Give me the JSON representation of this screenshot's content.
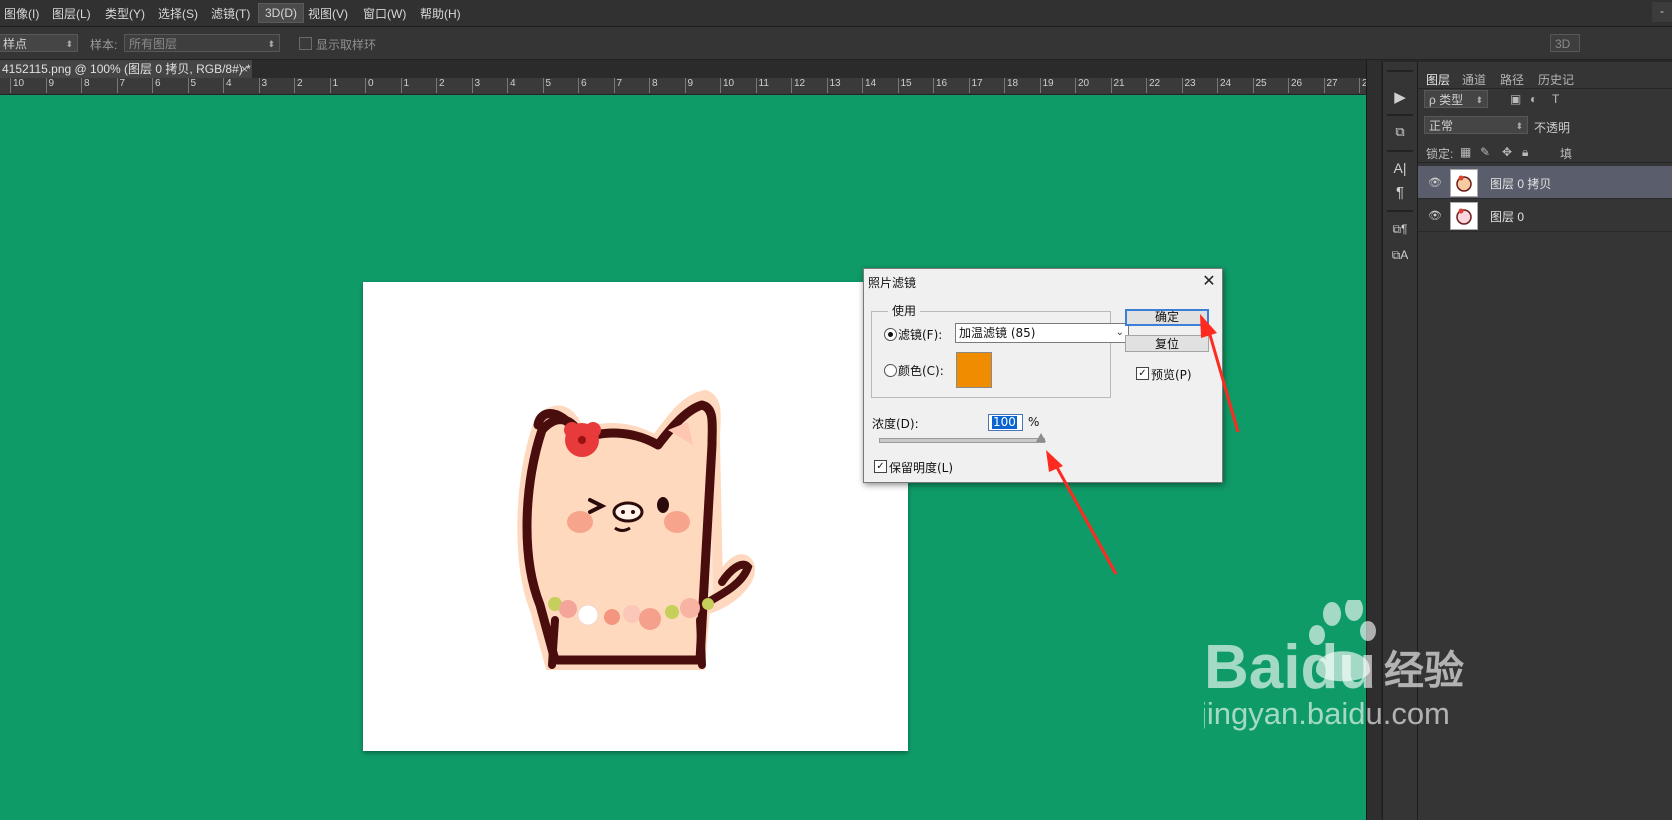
{
  "menu": [
    "图像(I)",
    "图层(L)",
    "类型(Y)",
    "选择(S)",
    "滤镜(T)",
    "3D(D)",
    "视图(V)",
    "窗口(W)",
    "帮助(H)"
  ],
  "window_control": "-",
  "options": {
    "sample_size": "样点",
    "sample_label": "样本:",
    "sample_value": "所有图层",
    "show_ring_label": "显示取样环",
    "right_mode": "3D"
  },
  "document_tab": {
    "title": "4152115.png @ 100% (图层 0 拷贝, RGB/8#) *",
    "close": "×"
  },
  "ruler_labels": [
    "10",
    "9",
    "8",
    "7",
    "6",
    "5",
    "4",
    "3",
    "2",
    "1",
    "0",
    "1",
    "2",
    "3",
    "4",
    "5",
    "6",
    "7",
    "8",
    "9",
    "10",
    "11",
    "12",
    "13",
    "14",
    "15",
    "16",
    "17",
    "18",
    "19",
    "20",
    "21",
    "22",
    "23",
    "24",
    "25",
    "26",
    "27",
    "2"
  ],
  "tool_icons": [
    "play-icon",
    "3d-cube-icon",
    "character-icon",
    "paragraph-icon",
    "paragraph-styles-icon",
    "character-styles-icon"
  ],
  "tool_glyphs": {
    "play": "▶",
    "cube": "⧉",
    "char": "A|",
    "para": "¶",
    "pstyle": "⧉¶",
    "cstyle": "⧉A"
  },
  "layers_panel": {
    "tabs": [
      "图层",
      "通道",
      "路径",
      "历史记"
    ],
    "filter_kind": "ρ 类型",
    "blend_mode": "正常",
    "opacity_label": "不透明",
    "lock_label": "锁定:",
    "fill_label": "填",
    "layers": [
      {
        "name": "图层 0 拷贝",
        "selected": true
      },
      {
        "name": "图层 0",
        "selected": false
      }
    ]
  },
  "dialog": {
    "title": "照片滤镜",
    "use_label": "使用",
    "filter_label": "滤镜(F):",
    "filter_value": "加温滤镜 (85)",
    "color_label": "颜色(C):",
    "color_value": "#f08c00",
    "density_label": "浓度(D):",
    "density_value": "100",
    "percent": "%",
    "density_fraction": 1.0,
    "preserve_label": "保留明度(L)",
    "ok_label": "确定",
    "reset_label": "复位",
    "preview_label": "预览(P)"
  },
  "watermark": {
    "brand": "Baidu",
    "cn": "经验",
    "url": "jingyan.baidu.com"
  },
  "colors": {
    "canvas_bg": "#0f9b68",
    "arrow": "#ff2a1f"
  }
}
